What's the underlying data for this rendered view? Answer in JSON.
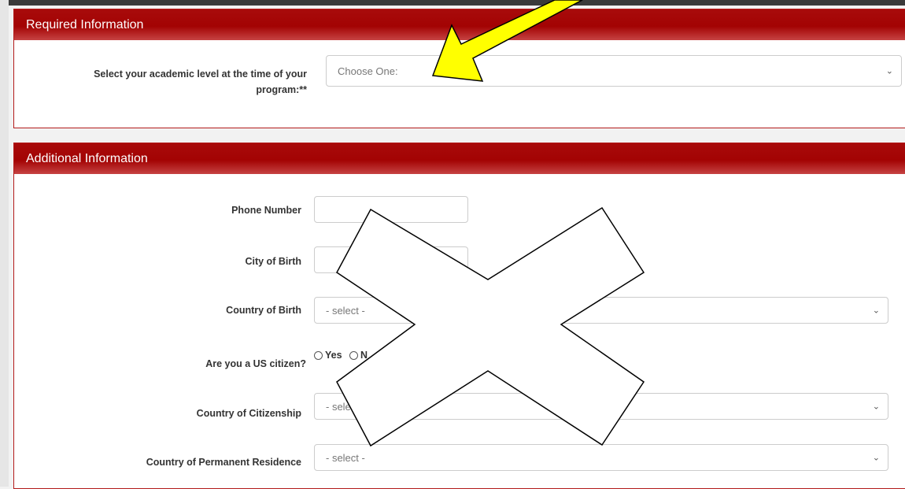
{
  "required": {
    "header": "Required Information",
    "academic_label": "Select your academic level at the time of your program:**",
    "academic_value": "Choose One:"
  },
  "additional": {
    "header": "Additional Information",
    "phone_label": "Phone Number",
    "phone_value": "",
    "city_label": "City of Birth",
    "city_value": "",
    "country_birth_label": "Country of Birth",
    "country_birth_value": "- select -",
    "us_citizen_label": "Are you a US citizen?",
    "us_citizen_yes": "Yes",
    "us_citizen_no": "N",
    "citizenship_label": "Country of Citizenship",
    "citizenship_value": "- sele",
    "residence_label": "Country of Permanent Residence",
    "residence_value": "- select -"
  },
  "annotations": {
    "arrow_color": "#ffff00",
    "cross_fill": "#ffffff"
  }
}
